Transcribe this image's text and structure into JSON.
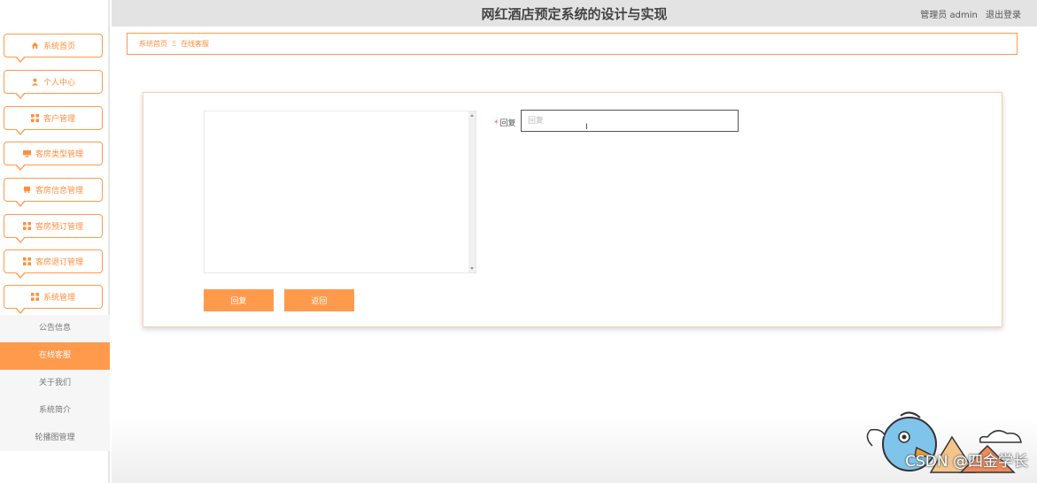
{
  "header": {
    "title": "网红酒店预定系统的设计与实现",
    "user_label": "管理员 admin",
    "logout_label": "退出登录"
  },
  "sidebar": {
    "items": [
      {
        "label": "系统首页",
        "icon": "home-icon"
      },
      {
        "label": "个人中心",
        "icon": "user-icon"
      },
      {
        "label": "客户管理",
        "icon": "grid-icon"
      },
      {
        "label": "客房类型管理",
        "icon": "monitor-icon"
      },
      {
        "label": "客房信息管理",
        "icon": "bed-icon"
      },
      {
        "label": "客房预订管理",
        "icon": "grid-icon"
      },
      {
        "label": "客房退订管理",
        "icon": "grid-icon"
      },
      {
        "label": "系统管理",
        "icon": "grid-icon"
      }
    ],
    "submenu": [
      {
        "label": "公告信息",
        "active": false
      },
      {
        "label": "在线客服",
        "active": true
      },
      {
        "label": "关于我们",
        "active": false
      },
      {
        "label": "系统简介",
        "active": false
      },
      {
        "label": "轮播图管理",
        "active": false
      }
    ]
  },
  "breadcrumb": {
    "home": "系统首页",
    "separator": "Ξ",
    "current": "在线客服"
  },
  "form": {
    "reply_label": "回复",
    "required_mark": "*",
    "reply_placeholder": "回复",
    "reply_value": ""
  },
  "buttons": {
    "reply": "回复",
    "back": "返回"
  },
  "watermark": {
    "text": "CSDN @四金学长"
  },
  "colors": {
    "accent": "#ff9a4d",
    "header_bg": "#e3e3e3"
  }
}
